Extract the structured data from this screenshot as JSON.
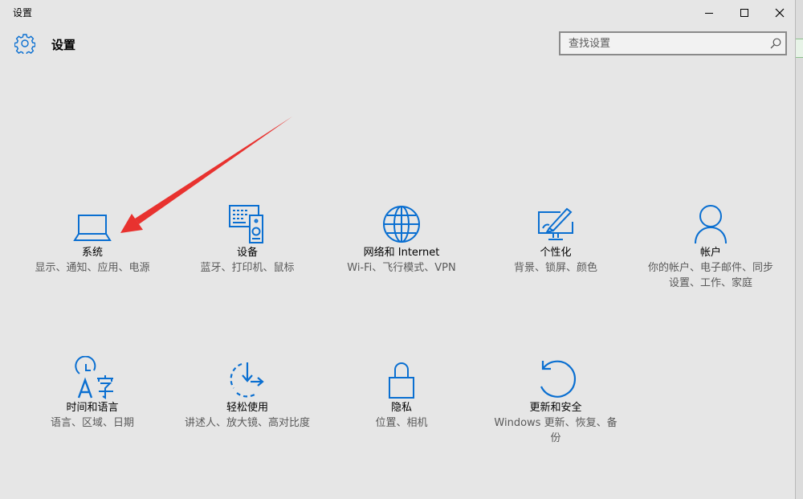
{
  "window": {
    "title": "设置"
  },
  "header": {
    "title": "设置"
  },
  "search": {
    "placeholder": "查找设置"
  },
  "tiles": [
    {
      "name": "系统",
      "desc": "显示、通知、应用、电源",
      "icon": "laptop-icon"
    },
    {
      "name": "设备",
      "desc": "蓝牙、打印机、鼠标",
      "icon": "devices-icon"
    },
    {
      "name": "网络和 Internet",
      "desc": "Wi-Fi、飞行模式、VPN",
      "icon": "globe-icon"
    },
    {
      "name": "个性化",
      "desc": "背景、锁屏、颜色",
      "icon": "personalization-icon"
    },
    {
      "name": "帐户",
      "desc": "你的帐户、电子邮件、同步设置、工作、家庭",
      "icon": "person-icon"
    },
    {
      "name": "时间和语言",
      "desc": "语言、区域、日期",
      "icon": "time-language-icon"
    },
    {
      "name": "轻松使用",
      "desc": "讲述人、放大镜、高对比度",
      "icon": "ease-of-access-icon"
    },
    {
      "name": "隐私",
      "desc": "位置、相机",
      "icon": "lock-icon"
    },
    {
      "name": "更新和安全",
      "desc": "Windows 更新、恢复、备份",
      "icon": "update-icon"
    }
  ],
  "colors": {
    "accent": "#0a6fd1",
    "arrow": "#e8322f",
    "background": "#e6e6e6"
  }
}
